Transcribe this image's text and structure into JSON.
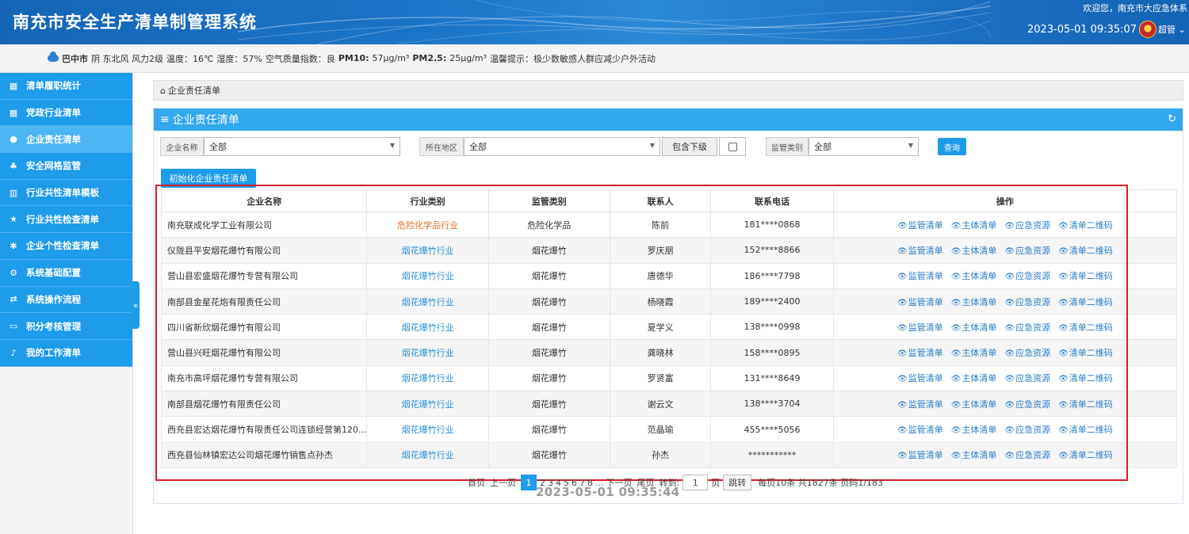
{
  "header": {
    "title": "南充市安全生产清单制管理系统",
    "welcome": "欢迎您，南充市大应急体系",
    "datetime": "2023-05-01 09:35:07",
    "user": "超管"
  },
  "weather": {
    "city": "巴中市",
    "condition": "阴 东北风 风力2级",
    "temp": "温度：16℃",
    "humidity": "湿度：57%",
    "aqi": "空气质量指数：良",
    "pm10_label": "PM10:",
    "pm10": "57μg/m³",
    "pm25_label": "PM2.5:",
    "pm25": "25μg/m³",
    "tip": "温馨提示：极少数敏感人群应减少户外活动"
  },
  "sidebar": {
    "items": [
      {
        "label": "清单履职统计",
        "icon": "grid-icon"
      },
      {
        "label": "党政行业清单",
        "icon": "grid-icon"
      },
      {
        "label": "企业责任清单",
        "icon": "circle-icon"
      },
      {
        "label": "安全网格监管",
        "icon": "sitemap-icon"
      },
      {
        "label": "行业共性清单模板",
        "icon": "columns-icon"
      },
      {
        "label": "行业共性检查清单",
        "icon": "star-icon"
      },
      {
        "label": "企业个性检查清单",
        "icon": "asterisk-icon"
      },
      {
        "label": "系统基础配置",
        "icon": "gears-icon"
      },
      {
        "label": "系统操作流程",
        "icon": "exchange-icon"
      },
      {
        "label": "积分考核管理",
        "icon": "monitor-icon"
      },
      {
        "label": "我的工作清单",
        "icon": "bell-icon"
      }
    ],
    "collapse": "«"
  },
  "breadcrumb": "企业责任清单",
  "panel": {
    "title": "企业责任清单",
    "filters": {
      "company_label": "企业名称",
      "company_value": "全部",
      "region_label": "所在地区",
      "region_value": "全部",
      "include_sub": "包含下级",
      "category_label": "监管类别",
      "category_value": "全部",
      "search": "查询"
    },
    "init_button": "初始化企业责任清单"
  },
  "table": {
    "headers": [
      "企业名称",
      "行业类别",
      "监管类别",
      "联系人",
      "联系电话",
      "操作"
    ],
    "op_labels": [
      "监管清单",
      "主体清单",
      "应急资源",
      "清单二维码"
    ],
    "rows": [
      {
        "name": "南充联成化学工业有限公司",
        "industry": "危险化学品行业",
        "category": "危险化学品",
        "contact": "陈前",
        "phone": "181****0868"
      },
      {
        "name": "仪陇县平安烟花爆竹有限公司",
        "industry": "烟花爆竹行业",
        "category": "烟花爆竹",
        "contact": "罗庆朋",
        "phone": "152****8866"
      },
      {
        "name": "营山县宏盛烟花爆竹专营有限公司",
        "industry": "烟花爆竹行业",
        "category": "烟花爆竹",
        "contact": "唐德华",
        "phone": "186****7798"
      },
      {
        "name": "南部县金星花炮有限责任公司",
        "industry": "烟花爆竹行业",
        "category": "烟花爆竹",
        "contact": "杨晓霞",
        "phone": "189****2400"
      },
      {
        "name": "四川省新欣烟花爆竹有限公司",
        "industry": "烟花爆竹行业",
        "category": "烟花爆竹",
        "contact": "夏学义",
        "phone": "138****0998"
      },
      {
        "name": "营山县兴旺烟花爆竹有限公司",
        "industry": "烟花爆竹行业",
        "category": "烟花爆竹",
        "contact": "龚晓林",
        "phone": "158****0895"
      },
      {
        "name": "南充市高坪烟花爆竹专营有限公司",
        "industry": "烟花爆竹行业",
        "category": "烟花爆竹",
        "contact": "罗贤富",
        "phone": "131****8649"
      },
      {
        "name": "南部县烟花爆竹有限责任公司",
        "industry": "烟花爆竹行业",
        "category": "烟花爆竹",
        "contact": "谢云文",
        "phone": "138****3704"
      },
      {
        "name": "西充县宏达烟花爆竹有限责任公司连锁经营第120...",
        "industry": "烟花爆竹行业",
        "category": "烟花爆竹",
        "contact": "范晶瑜",
        "phone": "455****5056"
      },
      {
        "name": "西充县仙林镇宏达公司烟花爆竹销售点孙杰",
        "industry": "烟花爆竹行业",
        "category": "烟花爆竹",
        "contact": "孙杰",
        "phone": "***********"
      }
    ]
  },
  "pager": {
    "first": "首页",
    "prev": "上一页",
    "current": "1",
    "pages": [
      "2",
      "3",
      "4",
      "5",
      "6",
      "7",
      "8",
      "..."
    ],
    "next": "下一页",
    "last": "尾页",
    "goto_label": "转到:",
    "goto_value": "1",
    "page_unit": "页",
    "jump": "跳转",
    "summary": "每页10条 共1827条 页码1/183"
  },
  "timestamp": "2023-05-01 09:35:44",
  "colors": {
    "primary": "#1e9be9",
    "header": "#1a6fc2",
    "highlight": "#d4202a",
    "hot_industry": "#e4702a"
  }
}
